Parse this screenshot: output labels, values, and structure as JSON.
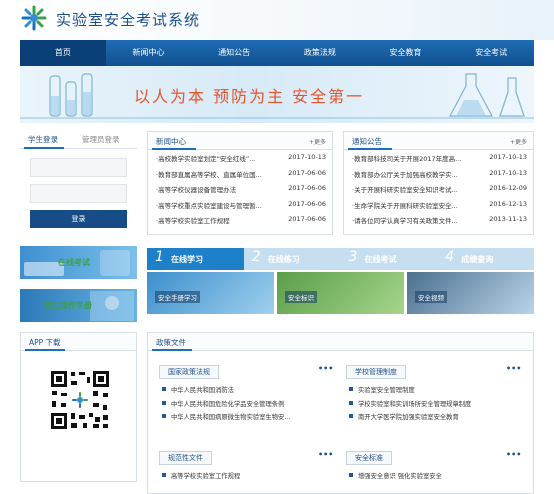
{
  "header": {
    "title": "实验室安全考试系统",
    "logo_icon": "virus-shaped-logo-icon",
    "colors": {
      "brand": "#1d4f8f",
      "nav": "#1565b0",
      "accent": "#e8542a"
    }
  },
  "nav": {
    "items": [
      {
        "label": "首页",
        "active": true
      },
      {
        "label": "新闻中心"
      },
      {
        "label": "通知公告"
      },
      {
        "label": "政策法规"
      },
      {
        "label": "安全教育"
      },
      {
        "label": "安全考试"
      }
    ]
  },
  "banner": {
    "slogan": "以人为本   预防为主   安全第一"
  },
  "login": {
    "tab_student": "学生登录",
    "tab_admin": "管理员登录",
    "button": "登录"
  },
  "news": {
    "title": "新闻中心",
    "more": "+更多",
    "items": [
      {
        "title": "·高校教学实验室划定“安全红线”...",
        "date": "2017-10-13"
      },
      {
        "title": "·教育部直属高等学校、直属单位国...",
        "date": "2017-06-06"
      },
      {
        "title": "·高等学校仪器设备管理办法",
        "date": "2017-06-06"
      },
      {
        "title": "·高等学校重点实验室建设与管理暂...",
        "date": "2017-06-06"
      },
      {
        "title": "·高等学校实验室工作规程",
        "date": "2017-06-06"
      }
    ]
  },
  "notices": {
    "title": "通知公告",
    "more": "+更多",
    "items": [
      {
        "title": "·教育部科技司关于开展2017年度高...",
        "date": "2017-10-13"
      },
      {
        "title": "·教育部办公厅关于加强高校教学实...",
        "date": "2017-10-13"
      },
      {
        "title": "·关于开展科研实验室安全知识考试...",
        "date": "2016-12-09"
      },
      {
        "title": "·生命学院关于开展科研实验室安全...",
        "date": "2016-12-13"
      },
      {
        "title": "·请各位同学认真学习有关政策文件...",
        "date": "2013-11-13"
      }
    ]
  },
  "side_tiles": {
    "online_exam": "在线考试",
    "handbook": "学生操作手册"
  },
  "steps": [
    {
      "num": "1",
      "label": "在线学习"
    },
    {
      "num": "2",
      "label": "在线练习"
    },
    {
      "num": "3",
      "label": "在线考试"
    },
    {
      "num": "4",
      "label": "成绩查询"
    }
  ],
  "thumbs": [
    {
      "caption": "安全手册学习"
    },
    {
      "caption": "安全标识"
    },
    {
      "caption": "安全视频"
    }
  ],
  "app": {
    "title": "APP 下载"
  },
  "policy": {
    "title": "政策文件",
    "groups": [
      {
        "name": "国家政策法规",
        "more": "•••",
        "items": [
          "中华人民共和国消防法",
          "中华人民共和国危险化学品安全管理条例",
          "中华人民共和国病原微生物实验室生物安..."
        ]
      },
      {
        "name": "学校管理制度",
        "more": "•••",
        "items": [
          "实验室安全管理制度",
          "学校实验室和实训场所安全管理规章制度",
          "南开大学医学院加强实验室安全教育"
        ]
      },
      {
        "name": "规范性文件",
        "more": "•••",
        "items": [
          "高等学校实验室工作规程"
        ]
      },
      {
        "name": "安全标准",
        "more": "•••",
        "items": [
          "增强安全意识 强化实验室安全"
        ]
      }
    ]
  }
}
